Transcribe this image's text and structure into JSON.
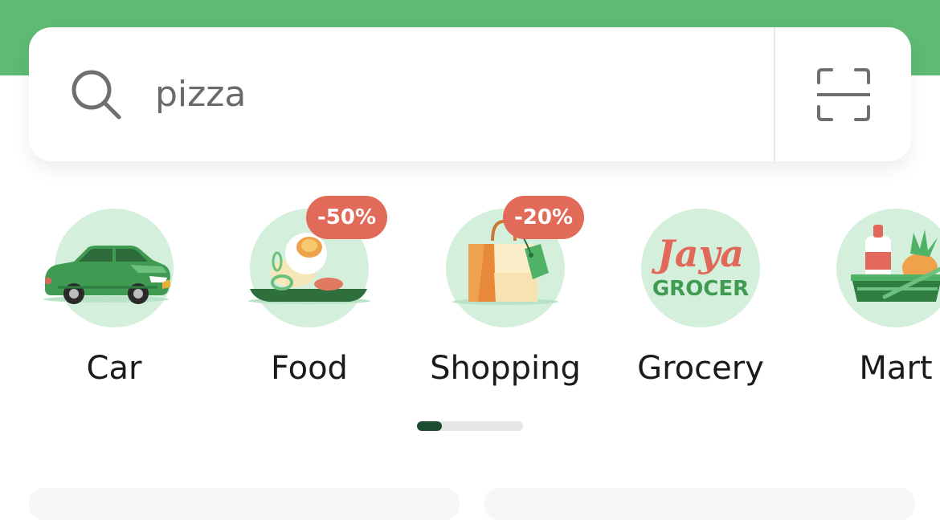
{
  "search": {
    "value": "pizza",
    "icon": "search-icon",
    "scan_icon": "scan-icon"
  },
  "categories": [
    {
      "label": "Car",
      "icon": "car-icon",
      "badge": ""
    },
    {
      "label": "Food",
      "icon": "food-icon",
      "badge": "-50%"
    },
    {
      "label": "Shopping",
      "icon": "shopping-bag-icon",
      "badge": "-20%"
    },
    {
      "label": "Grocery",
      "icon": "jaya-grocer-logo",
      "badge": "",
      "logo_text": [
        "Jaya",
        "GROCER"
      ]
    },
    {
      "label": "Mart",
      "icon": "mart-basket-icon",
      "badge": ""
    }
  ],
  "pager": {
    "current": 1,
    "progress": 0.23
  },
  "colors": {
    "header": "#5fba73",
    "icon_bg": "#d4efdc",
    "badge": "#e26a58",
    "pager_active": "#1c4d34",
    "pager_track": "#e6e6e6"
  }
}
